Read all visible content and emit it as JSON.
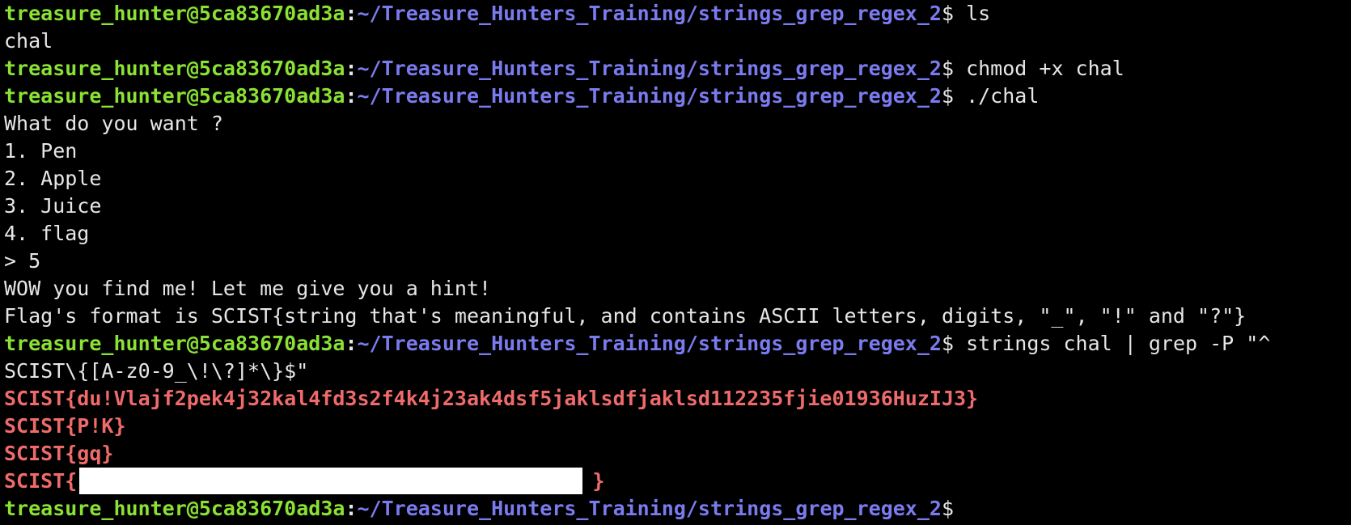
{
  "prompt": {
    "user": "treasure_hunter@5ca83670ad3a",
    "colon": ":",
    "path": "~/Treasure_Hunters_Training/strings_grep_regex_2",
    "dollar": "$"
  },
  "lines": {
    "cmd1": " ls",
    "out1": "chal",
    "cmd2": " chmod +x chal",
    "cmd3": " ./chal",
    "out_menu_title": "What do you want ?",
    "out_item1": "1. Pen",
    "out_item2": "2. Apple",
    "out_item3": "3. Juice",
    "out_item4": "4. flag",
    "out_input": "> 5",
    "out_wow": "WOW you find me! Let me give you a hint!",
    "out_format": "Flag's format is SCIST{string that's meaningful, and contains ASCII letters, digits, \"_\", \"!\" and \"?\"}",
    "cmd4": " strings chal | grep -P \"^",
    "cmd4_wrap": "SCIST\\{[A-z0-9_\\!\\?]*\\}$\"",
    "match1": "SCIST{du!Vlajf2pek4j32kal4fd3s2f4k4j23ak4dsf5jaklsdfjaklsd112235fjie01936HuzIJ3}",
    "match2": "SCIST{P!K}",
    "match3": "SCIST{gq}",
    "match4_prefix": "SCIST{",
    "match4_suffix": "}"
  },
  "colors": {
    "background": "#000000",
    "prompt_user": "#8ae234",
    "prompt_path": "#7b7bf0",
    "match_text": "#ef6b6b",
    "redaction": "#ffffff"
  }
}
